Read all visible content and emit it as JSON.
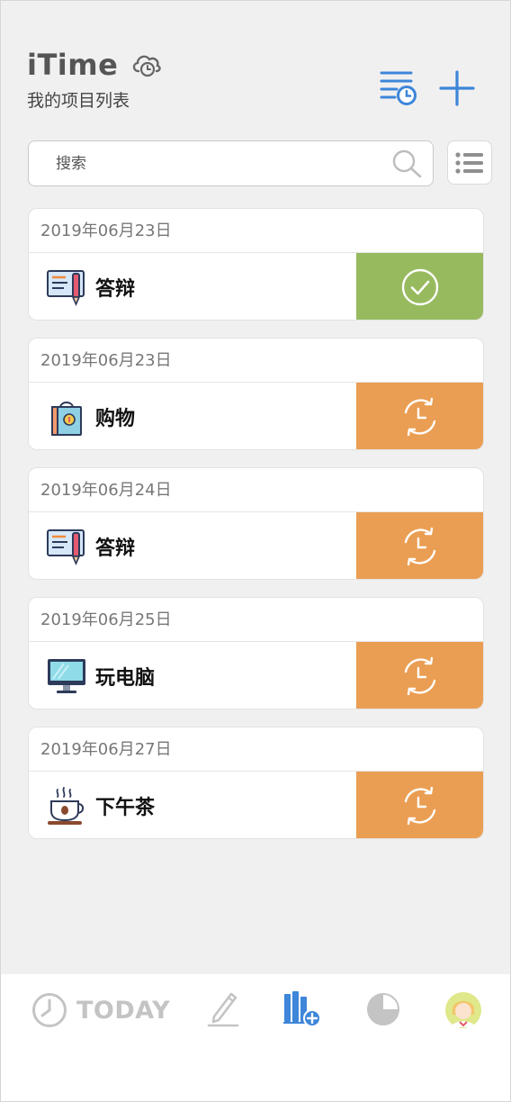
{
  "header": {
    "title": "iTime",
    "subtitle": "我的项目列表"
  },
  "search": {
    "placeholder": "搜索",
    "value": ""
  },
  "tasks": [
    {
      "date": "2019年06月23日",
      "name": "答辩",
      "icon": "presentation-icon",
      "status": "done",
      "status_color": "#97ba5f"
    },
    {
      "date": "2019年06月23日",
      "name": "购物",
      "icon": "shopping-bag-icon",
      "status": "pending",
      "status_color": "#ea9e53"
    },
    {
      "date": "2019年06月24日",
      "name": "答辩",
      "icon": "presentation-icon",
      "status": "pending",
      "status_color": "#ea9e53"
    },
    {
      "date": "2019年06月25日",
      "name": "玩电脑",
      "icon": "computer-icon",
      "status": "pending",
      "status_color": "#ea9e53"
    },
    {
      "date": "2019年06月27日",
      "name": "下午茶",
      "icon": "coffee-cup-icon",
      "status": "pending",
      "status_color": "#ea9e53"
    }
  ],
  "tabs": {
    "today_label": "TODAY"
  },
  "colors": {
    "accent_blue": "#3d86d9",
    "done_green": "#97ba5f",
    "pending_orange": "#ea9e53",
    "background": "#f1f0f1"
  }
}
